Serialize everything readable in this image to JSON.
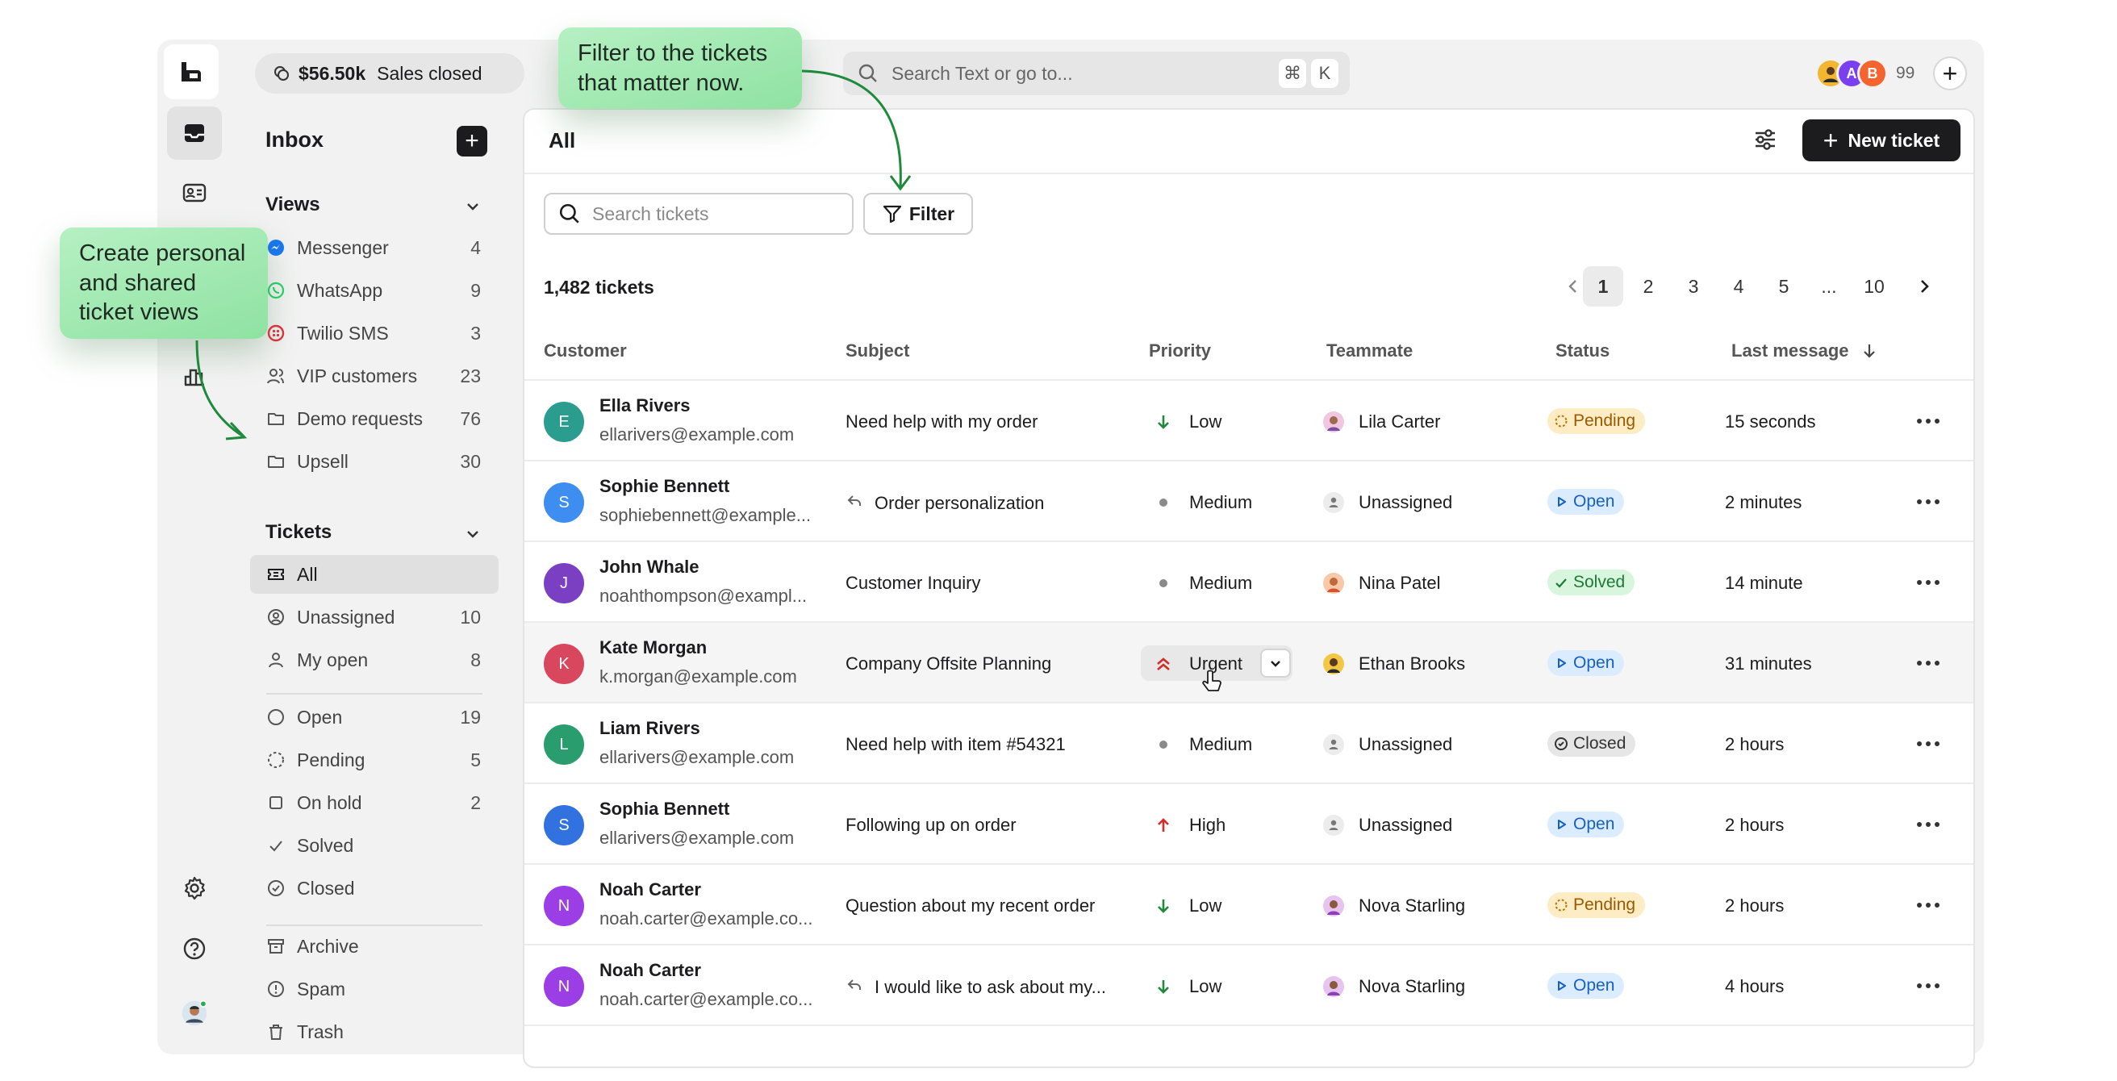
{
  "topbar": {
    "sales_amount": "$56.50k",
    "sales_label": "Sales closed",
    "search_placeholder": "Search Text or go to...",
    "shortcut_cmd": "⌘",
    "shortcut_key": "K",
    "avatar_letters": [
      "",
      "A",
      "B"
    ],
    "avatar_count": "99"
  },
  "sidebar": {
    "title": "Inbox",
    "views_heading": "Views",
    "views": [
      {
        "label": "Messenger",
        "count": "4",
        "icon": "messenger-icon"
      },
      {
        "label": "WhatsApp",
        "count": "9",
        "icon": "whatsapp-icon"
      },
      {
        "label": "Twilio SMS",
        "count": "3",
        "icon": "twilio-icon"
      },
      {
        "label": "VIP customers",
        "count": "23",
        "icon": "users-icon"
      },
      {
        "label": "Demo requests",
        "count": "76",
        "icon": "folder-icon"
      },
      {
        "label": "Upsell",
        "count": "30",
        "icon": "folder-icon"
      }
    ],
    "tickets_heading": "Tickets",
    "tickets": [
      {
        "label": "All",
        "count": "",
        "icon": "ticket-icon"
      },
      {
        "label": "Unassigned",
        "count": "10",
        "icon": "user-circle-icon"
      },
      {
        "label": "My open",
        "count": "8",
        "icon": "user-icon"
      },
      {
        "label": "Open",
        "count": "19",
        "icon": "circle-icon"
      },
      {
        "label": "Pending",
        "count": "5",
        "icon": "dashed-circle-icon"
      },
      {
        "label": "On hold",
        "count": "2",
        "icon": "square-icon"
      },
      {
        "label": "Solved",
        "count": "",
        "icon": "check-icon"
      },
      {
        "label": "Closed",
        "count": "",
        "icon": "check-circle-icon"
      },
      {
        "label": "Archive",
        "count": "",
        "icon": "archive-icon"
      },
      {
        "label": "Spam",
        "count": "",
        "icon": "alert-icon"
      },
      {
        "label": "Trash",
        "count": "",
        "icon": "trash-icon"
      }
    ]
  },
  "main": {
    "title": "All",
    "new_ticket_label": "New ticket",
    "search_placeholder": "Search tickets",
    "filter_label": "Filter",
    "ticket_count": "1,482 tickets",
    "pages": [
      "1",
      "2",
      "3",
      "4",
      "5",
      "...",
      "10"
    ],
    "current_page": "1",
    "columns": [
      "Customer",
      "Subject",
      "Priority",
      "Teammate",
      "Status",
      "Last message"
    ],
    "rows": [
      {
        "initial": "E",
        "avatar_color": "#2a9d8f",
        "name": "Ella Rivers",
        "email": "ellarivers@example.com",
        "subject": "Need help with my order",
        "reply": false,
        "priority": "Low",
        "prio_icon": "arrow-down",
        "teammate": "Lila Carter",
        "status": "Pending",
        "last": "15 seconds"
      },
      {
        "initial": "S",
        "avatar_color": "#3d8ef0",
        "name": "Sophie Bennett",
        "email": "sophiebennett@example...",
        "subject": "Order personalization",
        "reply": true,
        "priority": "Medium",
        "prio_icon": "dot",
        "teammate": "Unassigned",
        "status": "Open",
        "last": "2 minutes"
      },
      {
        "initial": "J",
        "avatar_color": "#7b3fc4",
        "name": "John Whale",
        "email": "noahthompson@exampl...",
        "subject": "Customer Inquiry",
        "reply": false,
        "priority": "Medium",
        "prio_icon": "dot",
        "teammate": "Nina Patel",
        "status": "Solved",
        "last": "14 minute"
      },
      {
        "initial": "K",
        "avatar_color": "#d9475e",
        "name": "Kate Morgan",
        "email": "k.morgan@example.com",
        "subject": "Company Offsite Planning",
        "reply": false,
        "priority": "Urgent",
        "prio_icon": "double-up",
        "teammate": "Ethan Brooks",
        "status": "Open",
        "last": "31 minutes"
      },
      {
        "initial": "L",
        "avatar_color": "#2a9d6f",
        "name": "Liam Rivers",
        "email": "ellarivers@example.com",
        "subject": "Need help with item #54321",
        "reply": false,
        "priority": "Medium",
        "prio_icon": "dot",
        "teammate": "Unassigned",
        "status": "Closed",
        "last": "2 hours"
      },
      {
        "initial": "S",
        "avatar_color": "#3172e0",
        "name": "Sophia Bennett",
        "email": "ellarivers@example.com",
        "subject": "Following up on order",
        "reply": false,
        "priority": "High",
        "prio_icon": "arrow-up",
        "teammate": "Unassigned",
        "status": "Open",
        "last": "2 hours"
      },
      {
        "initial": "N",
        "avatar_color": "#9b3ee6",
        "name": "Noah Carter",
        "email": "noah.carter@example.co...",
        "subject": "Question about my recent order",
        "reply": false,
        "priority": "Low",
        "prio_icon": "arrow-down",
        "teammate": "Nova Starling",
        "status": "Pending",
        "last": "2 hours"
      },
      {
        "initial": "N",
        "avatar_color": "#9b3ee6",
        "name": "Noah Carter",
        "email": "noah.carter@example.co...",
        "subject": "I would like to ask about my...",
        "reply": true,
        "priority": "Low",
        "prio_icon": "arrow-down",
        "teammate": "Nova Starling",
        "status": "Open",
        "last": "4 hours"
      }
    ]
  },
  "callouts": {
    "views": "Create personal and shared ticket views",
    "filter": "Filter to the tickets that matter now."
  },
  "colors": {
    "accent_dark": "#1c1c1e",
    "callout_green": "#9ee6ae",
    "arrow_green": "#1f8a3b",
    "pending_bg": "#fdecc4",
    "open_bg": "#dcecff",
    "solved_bg": "#d8f5dd",
    "closed_bg": "#e6e6e6"
  }
}
